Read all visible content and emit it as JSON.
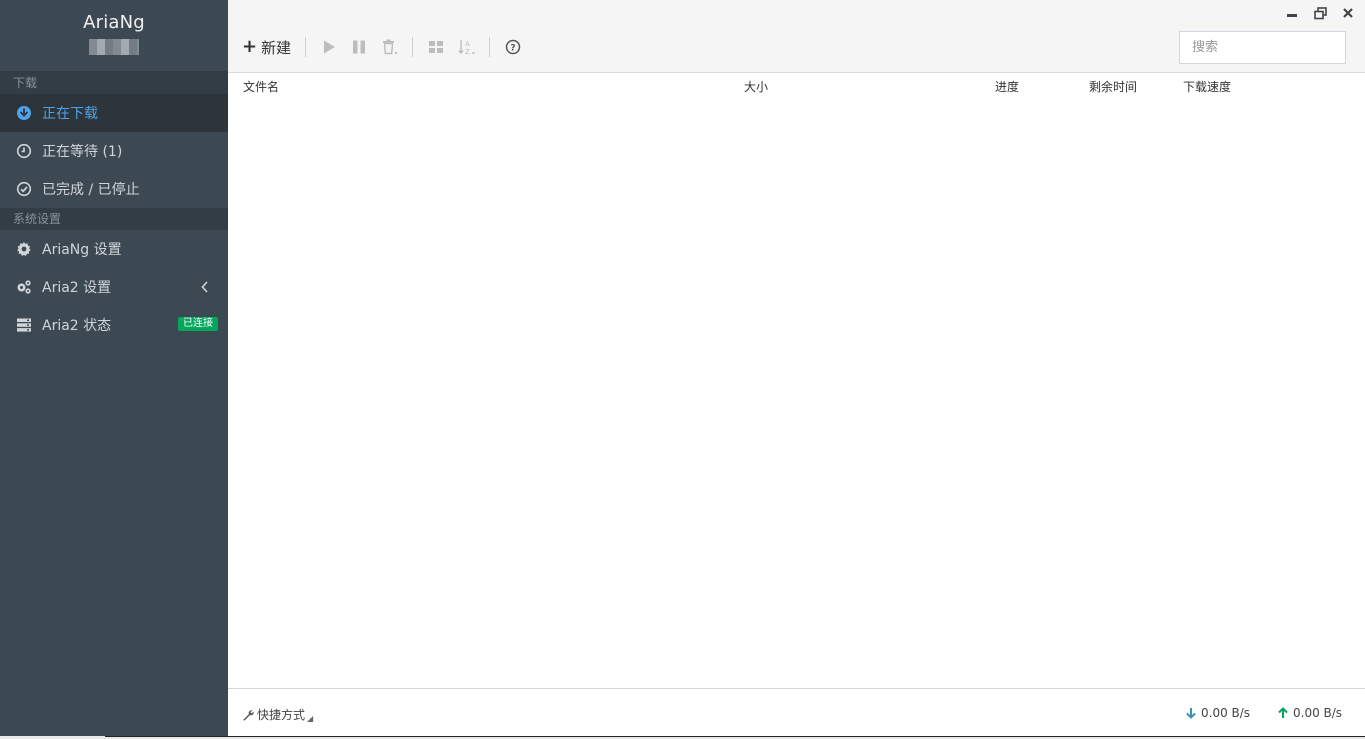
{
  "sidebar": {
    "brand_title": "AriaNg",
    "sections": [
      {
        "header": "下载",
        "items": [
          {
            "label": "正在下载",
            "icon": "download-circle-icon",
            "active": true
          },
          {
            "label": "正在等待 (1)",
            "icon": "clock-icon"
          },
          {
            "label": "已完成 / 已停止",
            "icon": "check-circle-icon"
          }
        ]
      },
      {
        "header": "系统设置",
        "items": [
          {
            "label": "AriaNg 设置",
            "icon": "gear-icon"
          },
          {
            "label": "Aria2 设置",
            "icon": "gears-icon"
          },
          {
            "label": "Aria2 状态",
            "icon": "server-icon",
            "badge": "已连接"
          }
        ]
      }
    ]
  },
  "toolbar": {
    "new_label": "新建",
    "search_placeholder": "搜索"
  },
  "table": {
    "columns": [
      "文件名",
      "大小",
      "进度",
      "剩余时间",
      "下载速度"
    ]
  },
  "footer": {
    "shortcut_label": "快捷方式",
    "download_speed": "0.00 B/s",
    "upload_speed": "0.00 B/s"
  },
  "colors": {
    "sidebar_bg": "#3c4852",
    "active_accent": "#4fa3ec",
    "badge_green": "#00a65a",
    "download_arrow": "#3c8dbc",
    "upload_arrow": "#00a65a"
  }
}
